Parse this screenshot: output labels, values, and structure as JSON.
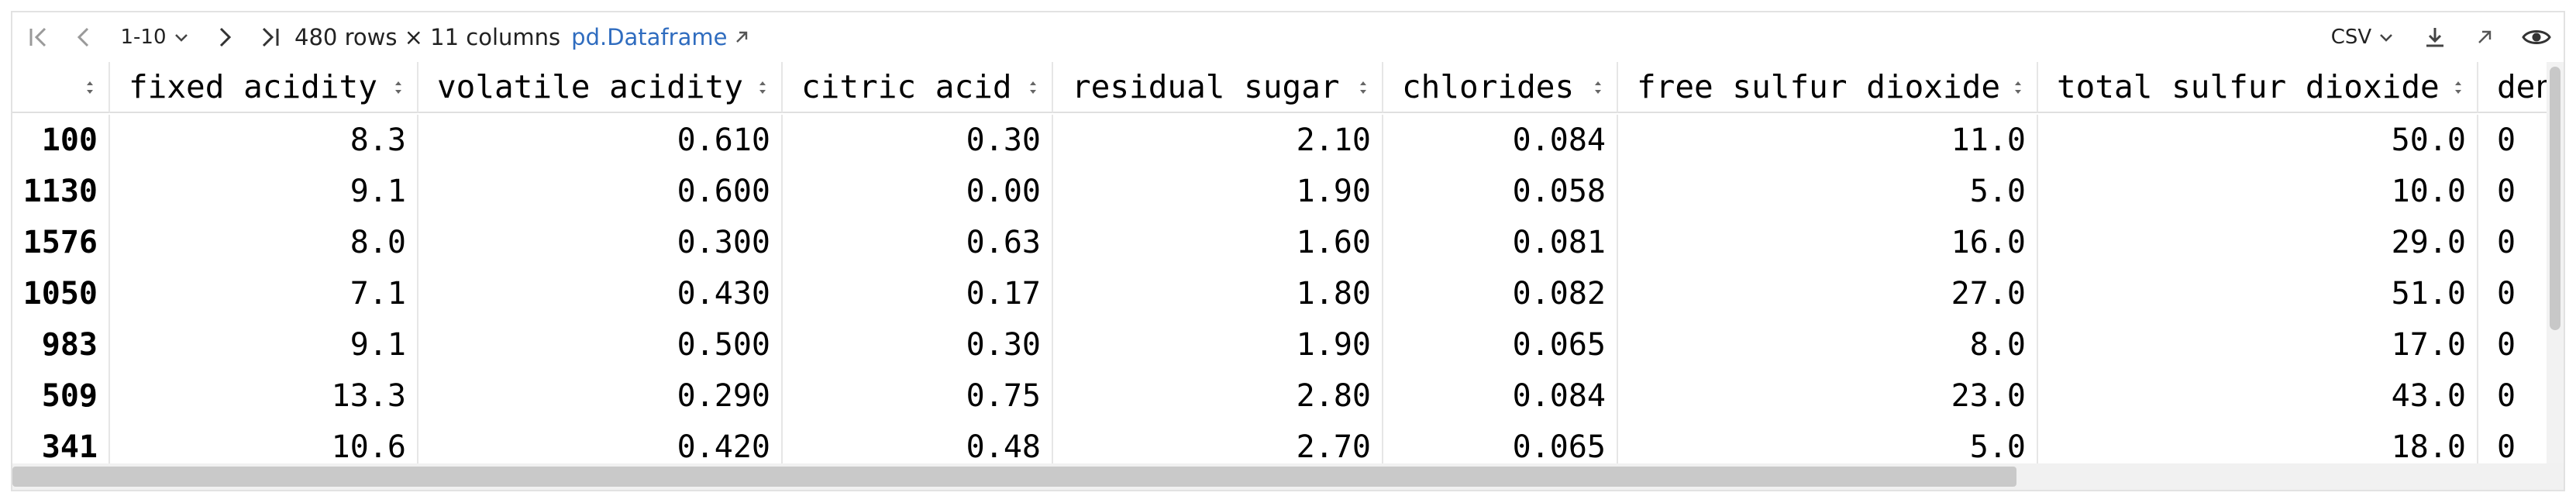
{
  "toolbar": {
    "page_range": "1-10",
    "summary": "480 rows × 11 columns",
    "type_link": "pd.Dataframe",
    "export_format": "CSV"
  },
  "table": {
    "columns": [
      "",
      "fixed acidity",
      "volatile acidity",
      "citric acid",
      "residual sugar",
      "chlorides",
      "free sulfur dioxide",
      "total sulfur dioxide",
      "den"
    ],
    "rows": [
      [
        "100",
        "8.3",
        "0.610",
        "0.30",
        "2.10",
        "0.084",
        "11.0",
        "50.0",
        "0"
      ],
      [
        "1130",
        "9.1",
        "0.600",
        "0.00",
        "1.90",
        "0.058",
        "5.0",
        "10.0",
        "0"
      ],
      [
        "1576",
        "8.0",
        "0.300",
        "0.63",
        "1.60",
        "0.081",
        "16.0",
        "29.0",
        "0"
      ],
      [
        "1050",
        "7.1",
        "0.430",
        "0.17",
        "1.80",
        "0.082",
        "27.0",
        "51.0",
        "0"
      ],
      [
        "983",
        "9.1",
        "0.500",
        "0.30",
        "1.90",
        "0.065",
        "8.0",
        "17.0",
        "0"
      ],
      [
        "509",
        "13.3",
        "0.290",
        "0.75",
        "2.80",
        "0.084",
        "23.0",
        "43.0",
        "0"
      ],
      [
        "341",
        "10.6",
        "0.420",
        "0.48",
        "2.70",
        "0.065",
        "5.0",
        "18.0",
        "0"
      ]
    ]
  },
  "icons": {
    "first_page": "first-page-icon",
    "prev_page": "prev-page-icon",
    "next_page": "next-page-icon",
    "last_page": "last-page-icon",
    "external_link": "external-link-icon",
    "download": "download-icon",
    "open_in_window": "open-icon",
    "view": "eye-icon",
    "sort": "sort-icon"
  },
  "colors": {
    "link": "#2f6cbf",
    "border": "#e2e2e2",
    "text": "#000000"
  }
}
